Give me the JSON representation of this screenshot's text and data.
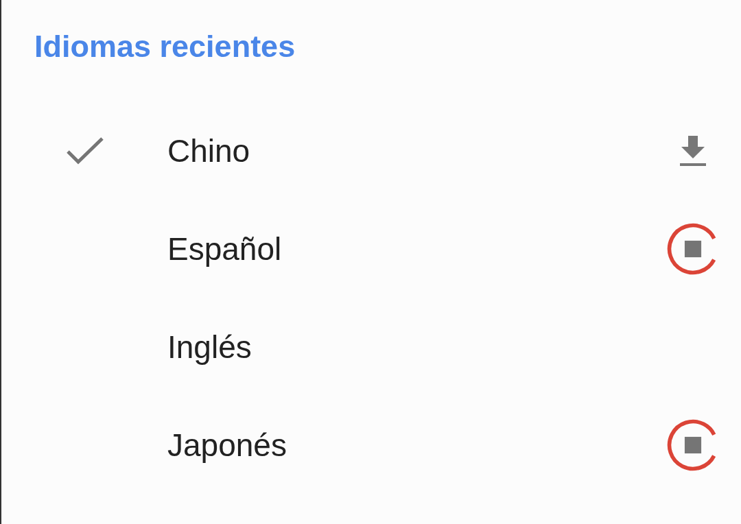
{
  "section": {
    "title": "Idiomas recientes"
  },
  "languages": [
    {
      "name": "Chino",
      "selected": true,
      "kind": "download"
    },
    {
      "name": "Español",
      "selected": false,
      "kind": "downloading"
    },
    {
      "name": "Inglés",
      "selected": false,
      "kind": "none"
    },
    {
      "name": "Japonés",
      "selected": false,
      "kind": "downloading"
    }
  ]
}
